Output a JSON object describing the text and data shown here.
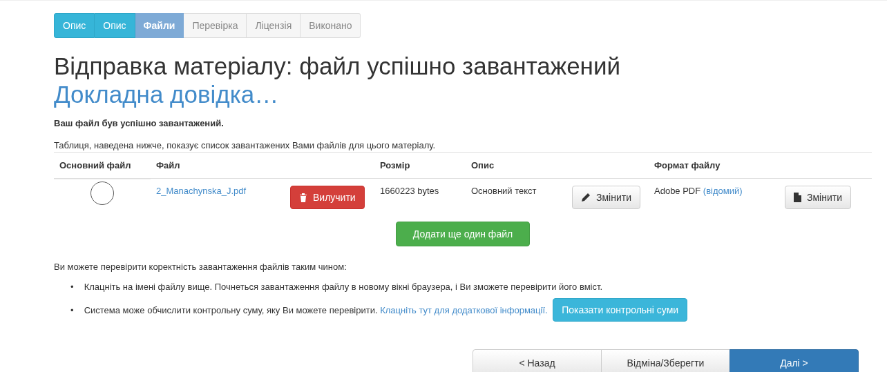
{
  "steps": [
    {
      "label": "Опис",
      "kind": "done"
    },
    {
      "label": "Опис",
      "kind": "done"
    },
    {
      "label": "Файли",
      "kind": "current"
    },
    {
      "label": "Перевірка",
      "kind": "pending"
    },
    {
      "label": "Ліцензія",
      "kind": "pending"
    },
    {
      "label": "Виконано",
      "kind": "pending"
    }
  ],
  "heading": {
    "text": "Відправка матеріалу: файл успішно завантажений",
    "help_link": "Докладна довідка…"
  },
  "success_message": "Ваш файл був успішно завантажений.",
  "table_intro": "Таблиця, наведена нижче, показує список завантажених Вами файлів для цього матеріалу.",
  "table": {
    "columns": [
      "Основний файл",
      "Файл",
      "Розмір",
      "Опис",
      "Формат файлу"
    ],
    "rows": [
      {
        "primary": {
          "checked": false
        },
        "file": "2_Manachynska_J.pdf",
        "remove_button": "Вилучити",
        "size": "1660223 bytes",
        "description": "Основний текст",
        "edit_description_button": "Змінити",
        "format": "Adobe PDF",
        "format_status": "(відомий)",
        "edit_format_button": "Змінити"
      }
    ]
  },
  "add_file_button": "Додати ще один файл",
  "verify_intro": "Ви можете перевірити коректність завантаження файлів таким чином:",
  "verify_items": [
    {
      "marker": "•",
      "text": "Клацніть на імені файлу вище. Почнеться завантаження файлу в новому вікні браузера, і Ви зможете перевірити його вміст."
    },
    {
      "marker": "•",
      "text": "Система може обчислити контрольну суму, яку Ви можете перевірити.",
      "link": "Клацніть тут для додаткової інформації.",
      "button": "Показати контрольні суми"
    }
  ],
  "nav_buttons": [
    {
      "label": "< Назад",
      "kind": "default"
    },
    {
      "label": "Відміна/Зберегти",
      "kind": "default"
    },
    {
      "label": "Далі >",
      "kind": "primary"
    }
  ]
}
